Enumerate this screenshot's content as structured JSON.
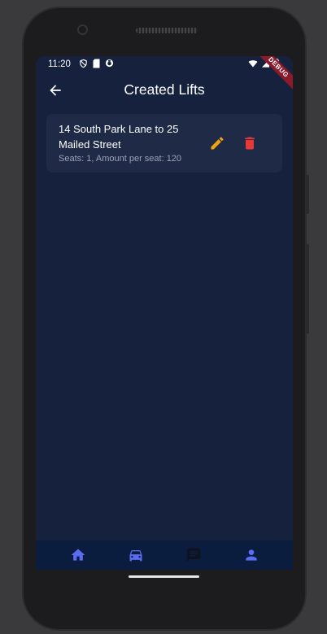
{
  "status_bar": {
    "time": "11:20"
  },
  "debug_banner": "DEBUG",
  "app_bar": {
    "title": "Created Lifts"
  },
  "lifts": [
    {
      "route": "14 South Park Lane to 25 Mailed Street",
      "details": "Seats: 1, Amount per seat: 120"
    }
  ],
  "bottom_nav": [
    {
      "icon": "home-icon",
      "color": "#5b6cf0"
    },
    {
      "icon": "car-icon",
      "color": "#5b6cf0"
    },
    {
      "icon": "chat-icon",
      "color": "#0f1320"
    },
    {
      "icon": "person-icon",
      "color": "#5b6cf0"
    }
  ],
  "colors": {
    "background": "#16213e",
    "card": "#1f2a47",
    "edit": "#f2a20f",
    "delete": "#e53935",
    "nav_bar": "#0a1d3f"
  }
}
